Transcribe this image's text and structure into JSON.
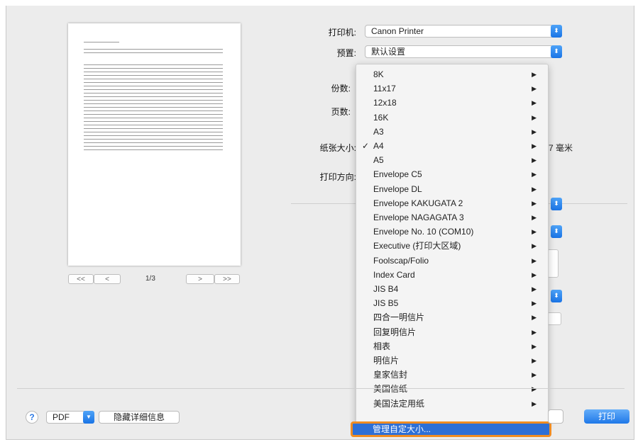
{
  "printer": {
    "label": "打印机:",
    "value": "Canon Printer"
  },
  "preset": {
    "label": "预置:",
    "value": "默认设置"
  },
  "copies": {
    "label": "份数:"
  },
  "pages": {
    "label": "页数:"
  },
  "paper_size": {
    "label": "纸张大小:",
    "suffix": "7 毫米"
  },
  "orientation": {
    "label": "打印方向:"
  },
  "pager": {
    "first": "<<",
    "prev": "<",
    "count": "1/3",
    "next": ">",
    "last": ">>"
  },
  "menu": {
    "items": [
      {
        "label": "8K",
        "checked": false
      },
      {
        "label": "11x17",
        "checked": false
      },
      {
        "label": "12x18",
        "checked": false
      },
      {
        "label": "16K",
        "checked": false
      },
      {
        "label": "A3",
        "checked": false
      },
      {
        "label": "A4",
        "checked": true
      },
      {
        "label": "A5",
        "checked": false
      },
      {
        "label": "Envelope C5",
        "checked": false
      },
      {
        "label": "Envelope DL",
        "checked": false
      },
      {
        "label": "Envelope KAKUGATA 2",
        "checked": false
      },
      {
        "label": "Envelope NAGAGATA 3",
        "checked": false
      },
      {
        "label": "Envelope No. 10 (COM10)",
        "checked": false
      },
      {
        "label": "Executive (打印大区域)",
        "checked": false
      },
      {
        "label": "Foolscap/Folio",
        "checked": false
      },
      {
        "label": "Index Card",
        "checked": false
      },
      {
        "label": "JIS B4",
        "checked": false
      },
      {
        "label": "JIS B5",
        "checked": false
      },
      {
        "label": "四合一明信片",
        "checked": false
      },
      {
        "label": "回复明信片",
        "checked": false
      },
      {
        "label": "相表",
        "checked": false
      },
      {
        "label": "明信片",
        "checked": false
      },
      {
        "label": "皇家信封",
        "checked": false
      },
      {
        "label": "美国信纸",
        "checked": false
      },
      {
        "label": "美国法定用纸",
        "checked": false
      }
    ],
    "check_mark": "✓",
    "submenu_arrow": "▶",
    "manage_label": "管理自定大小..."
  },
  "footer": {
    "help": "?",
    "pdf": "PDF",
    "hide_details": "隐藏详细信息",
    "print": "打印"
  },
  "colors": {
    "accent": "#1f78e8",
    "highlight_border": "#f08c22",
    "selected_bg": "#2d6fd6"
  }
}
